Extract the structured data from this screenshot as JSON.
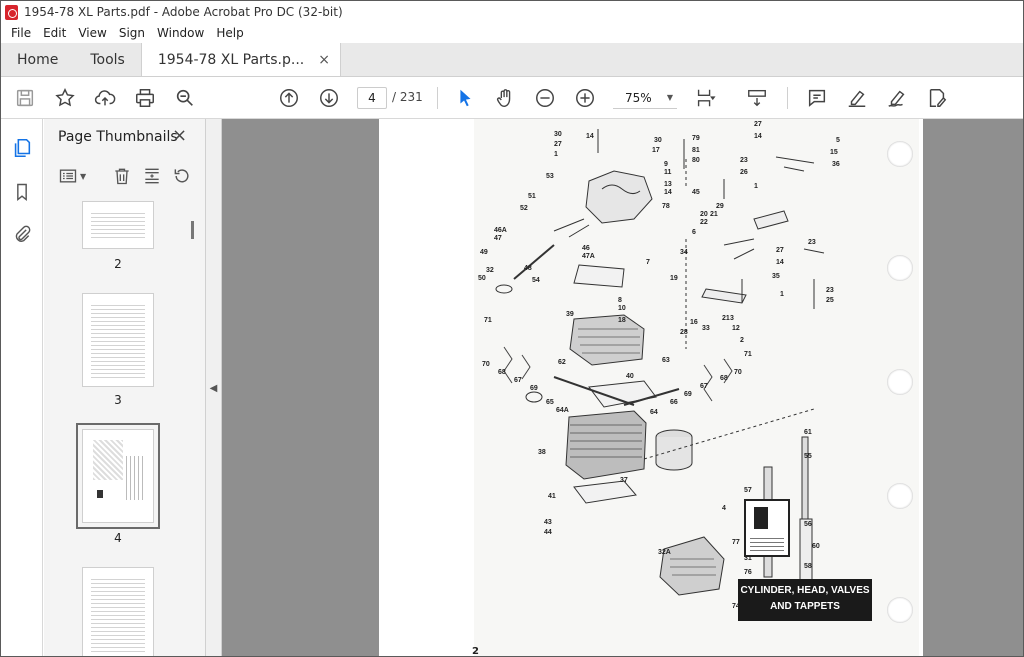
{
  "window": {
    "title": "1954-78 XL Parts.pdf - Adobe Acrobat Pro DC (32-bit)"
  },
  "menu": [
    "File",
    "Edit",
    "View",
    "Sign",
    "Window",
    "Help"
  ],
  "tabs": {
    "home": "Home",
    "tools": "Tools",
    "document": "1954-78 XL Parts.p...",
    "close": "×"
  },
  "toolbar": {
    "current_page": "4",
    "total_pages": "/ 231",
    "zoom": "75%"
  },
  "thumbnails": {
    "title": "Page Thumbnails",
    "close": "×",
    "pages": [
      {
        "label": "2"
      },
      {
        "label": "3"
      },
      {
        "label": "4",
        "selected": true
      },
      {
        "label": ""
      }
    ]
  },
  "document": {
    "caption_line1": "CYLINDER, HEAD, VALVES",
    "caption_line2": "AND TAPPETS",
    "page_footer": "2",
    "part_numbers": [
      "30",
      "14",
      "30",
      "27",
      "17",
      "1",
      "79",
      "81",
      "80",
      "27",
      "14",
      "5",
      "15",
      "36",
      "23",
      "26",
      "1",
      "53",
      "9",
      "11",
      "13",
      "14",
      "45",
      "78",
      "29",
      "21",
      "20",
      "22",
      "6",
      "34",
      "51",
      "52",
      "46A",
      "47",
      "49",
      "32",
      "50",
      "48",
      "46",
      "47A",
      "54",
      "7",
      "19",
      "8",
      "10",
      "18",
      "16",
      "33",
      "28",
      "21",
      "12",
      "3",
      "2",
      "39",
      "71",
      "70",
      "68",
      "67",
      "69",
      "62",
      "65",
      "64A",
      "63",
      "40",
      "64",
      "66",
      "69",
      "67",
      "68",
      "70",
      "71",
      "38",
      "37",
      "41",
      "61",
      "55",
      "4",
      "57",
      "77",
      "61",
      "56",
      "60",
      "31",
      "58",
      "76",
      "75",
      "72",
      "74",
      "73",
      "59",
      "24",
      "61",
      "32A",
      "43",
      "44",
      "27",
      "14",
      "35",
      "23",
      "25",
      "1",
      "23"
    ]
  }
}
